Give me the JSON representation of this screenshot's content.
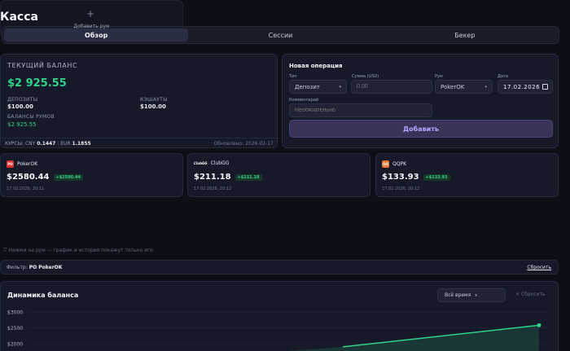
{
  "app": {
    "title": "Касса"
  },
  "tabs": [
    {
      "label": "Обзор",
      "active": true
    },
    {
      "label": "Сессии",
      "active": false
    },
    {
      "label": "Бекер",
      "active": false
    }
  ],
  "balance": {
    "label": "ТЕКУЩИЙ БАЛАНС",
    "value": "$2 925.55",
    "deposits_label": "ДЕПОЗИТЫ",
    "deposits": "$100.00",
    "cashouts_label": "КЭШАУТЫ",
    "cashouts": "$100.00",
    "rooms_label": "БАЛАНСЫ РУМОВ",
    "rooms": "$2 925.55",
    "rates_label": "КУРСЫ:",
    "cny_label": "CNY",
    "cny": "0.1447",
    "eur_label": "EUR",
    "eur": "1.1855",
    "updated": "Обновлено: 2026-02-17"
  },
  "operation": {
    "title": "Новая операция",
    "type_label": "Тип",
    "type_value": "Депозит",
    "amount_label": "Сумма (USD)",
    "amount_placeholder": "0.00",
    "room_label": "Рум",
    "room_value": "PokerOK",
    "date_label": "Дата",
    "date_value": "17.02.2026",
    "comment_label": "Комментарий",
    "comment_placeholder": "Необязательно",
    "submit": "Добавить"
  },
  "rooms": [
    {
      "badge": "PO",
      "badge_color": "#d8322f",
      "name": "PokerOK",
      "amount": "$2580.44",
      "delta": "+$2580.44",
      "date": "17.02.2026, 20:11"
    },
    {
      "badge": "ClubGG",
      "badge_color": "#161a28",
      "name": "ClubGG",
      "amount": "$211.18",
      "delta": "+$211.18",
      "date": "17.02.2026, 20:12"
    },
    {
      "badge": "QQ",
      "badge_color": "#e8742a",
      "name": "QQPK",
      "amount": "$133.93",
      "delta": "+$133.93",
      "date": "17.02.2026, 20:12"
    }
  ],
  "add_room": {
    "icon": "plus-icon",
    "label": "Добавить рум"
  },
  "hint": "Нажми на рум — график и история покажут только его",
  "filter": {
    "label": "Фильтр:",
    "value": "PO PokerOK",
    "reset": "Сбросить"
  },
  "chart": {
    "title": "Динамика баланса",
    "range": "Всё время",
    "reset": "Сбросить"
  },
  "chart_data": {
    "type": "area",
    "title": "Динамика баланса",
    "y_ticks": [
      "$3000",
      "$2500",
      "$2000"
    ],
    "ylim": [
      2000,
      3000
    ],
    "series": [
      {
        "values": [
          1900,
          2580.44
        ]
      }
    ],
    "colors": {
      "line": "#2fd18b",
      "fill": "#1f5a44"
    },
    "grid": true
  }
}
